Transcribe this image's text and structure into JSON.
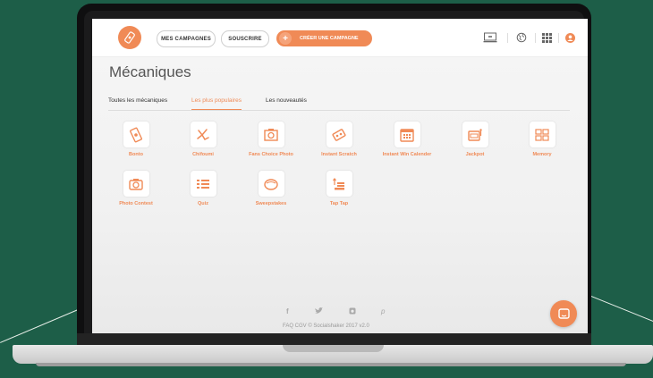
{
  "header": {
    "nav": [
      "MES CAMPAGNES",
      "SOUSCRIRE"
    ],
    "create_label": "CRÉER UNE CAMPAGNE",
    "icons": [
      "monitor-icon",
      "globe-icon",
      "grid-icon",
      "user-icon"
    ]
  },
  "page": {
    "title": "Mécaniques",
    "tabs": [
      "Toutes les mécaniques",
      "Les plus populaires",
      "Les nouveautés"
    ],
    "active_tab": "Les plus populaires"
  },
  "mechanics": [
    {
      "label": "Bonto",
      "icon": "ticket-icon"
    },
    {
      "label": "Chifoumi",
      "icon": "hand-icon"
    },
    {
      "label": "Fans Choice Photo",
      "icon": "photo-frame-icon"
    },
    {
      "label": "Instant Scratch",
      "icon": "scratch-ticket-icon"
    },
    {
      "label": "Instant Win Calender",
      "icon": "calendar-icon"
    },
    {
      "label": "Jackpot",
      "icon": "slot-machine-icon"
    },
    {
      "label": "Memory",
      "icon": "memory-grid-icon"
    },
    {
      "label": "Photo Contest",
      "icon": "camera-icon"
    },
    {
      "label": "Quiz",
      "icon": "quiz-list-icon"
    },
    {
      "label": "Sweepstakes",
      "icon": "bowl-icon"
    },
    {
      "label": "Tap Tap",
      "icon": "tap-coins-icon"
    }
  ],
  "footer": {
    "links_text": "FAQ  CGV  © Socialshaker 2017  v2.0",
    "social": [
      "facebook-icon",
      "twitter-icon",
      "instagram-icon",
      "pinterest-icon"
    ]
  },
  "colors": {
    "accent": "#f08a56",
    "background": "#1d5e48"
  }
}
